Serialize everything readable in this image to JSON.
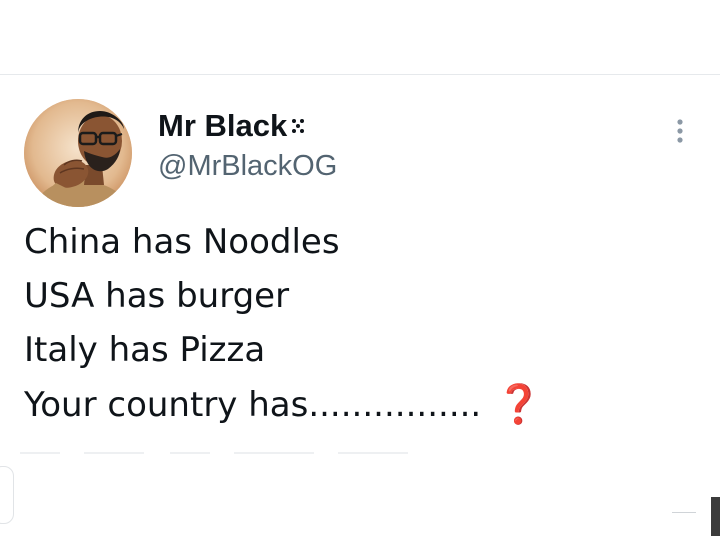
{
  "tweet": {
    "author": {
      "display_name": "Mr Black",
      "handle": "@MrBlackOG",
      "avatar_icon": "avatar-portrait-man-glasses-icon"
    },
    "more_icon": "more-vertical-icon",
    "text_lines": [
      "China has Noodles",
      "USA has burger",
      "Italy has Pizza",
      "Your country has................"
    ],
    "trailing_emoji": "❓"
  },
  "colors": {
    "text": "#0f1419",
    "secondary": "#536471",
    "question_mark": "#dd2e44",
    "divider": "#e6e9ec"
  }
}
